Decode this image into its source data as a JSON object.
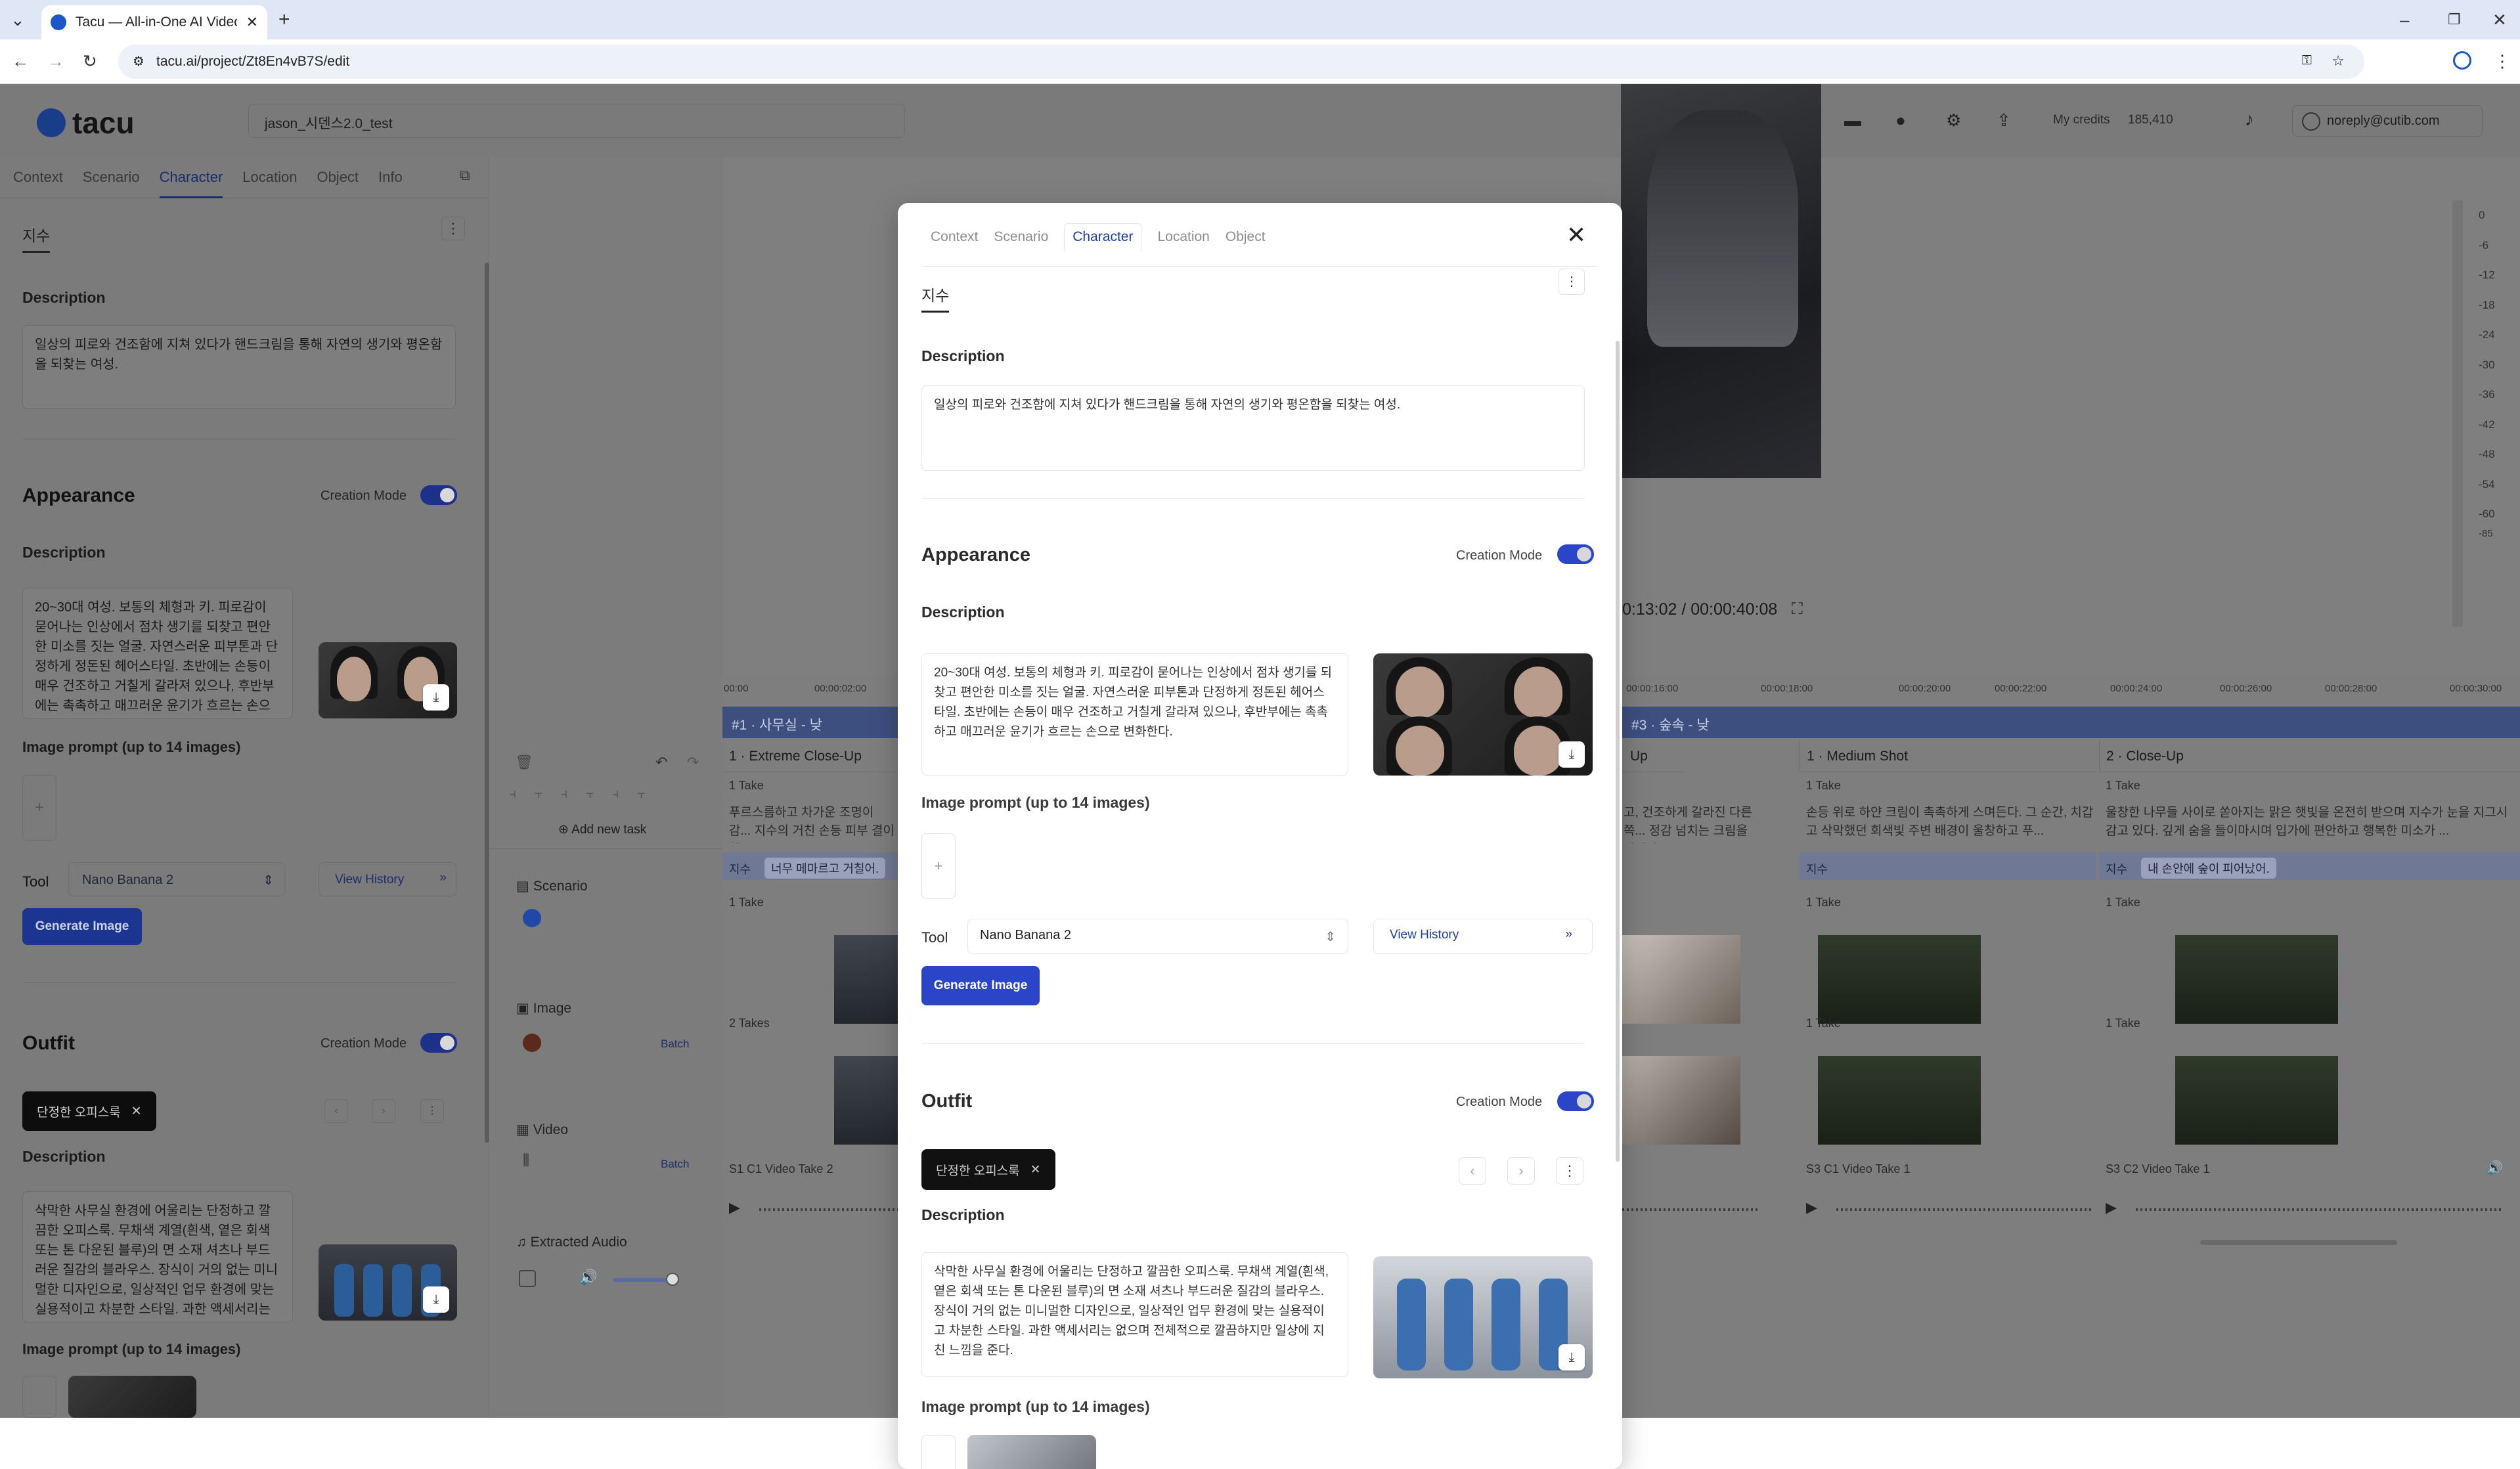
{
  "browser": {
    "tab_title": "Tacu — All-in-One AI Video P",
    "url": "tacu.ai/project/Zt8En4vB7S/edit"
  },
  "app": {
    "logo": "tacu",
    "project_name": "jason_시덴스2.0_test",
    "credits_label": "My credits",
    "credits_value": "185,410",
    "user_email": "noreply@cutib.com"
  },
  "left_panel": {
    "tabs": [
      "Context",
      "Scenario",
      "Character",
      "Location",
      "Object",
      "Info"
    ],
    "character_name": "지수",
    "description_title": "Description",
    "description": "일상의 피로와 건조함에 지쳐 있다가 핸드크림을 통해 자연의 생기와 평온함을 되찾는 여성.",
    "appearance_title": "Appearance",
    "creation_mode": "Creation Mode",
    "appearance_desc_title": "Description",
    "appearance_desc": "20~30대 여성. 보통의 체형과 키. 피로감이 묻어나는 인상에서 점차 생기를 되찾고 편안한 미소를 짓는 얼굴. 자연스러운 피부톤과 단정하게 정돈된 헤어스타일. 초반에는 손등이 매우 건조하고 거칠게 갈라져 있으나, 후반부에는 촉촉하고 매끄러운 윤기가 흐르는 손으",
    "image_prompt": "Image prompt (up to 14 images)",
    "tool": "Tool",
    "tool_value": "Nano Banana 2",
    "view_history": "View History",
    "generate": "Generate Image",
    "outfit_title": "Outfit",
    "outfit_chip": "단정한 오피스룩",
    "outfit_desc_title": "Description",
    "outfit_desc": "삭막한 사무실 환경에 어울리는 단정하고 깔끔한 오피스룩. 무채색 계열(흰색, 옅은 회색 또는 톤 다운된 블루)의 면 소재 셔츠나 부드러운 질감의 블라우스. 장식이 거의 없는 미니멀한 디자인으로, 일상적인 업무 환경에 맞는 실용적이고 차분한 스타일. 과한 액세서리는",
    "image_prompt2": "Image prompt (up to 14 images)"
  },
  "middle": {
    "add_task": "Add new task",
    "rows": [
      {
        "label": "Scenario"
      },
      {
        "label": "Image",
        "batch": "Batch"
      },
      {
        "label": "Video",
        "batch": "Batch"
      },
      {
        "label": "Extracted Audio"
      }
    ]
  },
  "timeline": {
    "ruler": [
      "00:00",
      "00:00:02:00",
      "00:00:16:00",
      "00:00:18:00",
      "00:00:20:00",
      "00:00:22:00",
      "00:00:24:00",
      "00:00:26:00",
      "00:00:28:00",
      "00:00:30:00"
    ],
    "groups": [
      {
        "label": "#1 · 사무실 - 낮"
      },
      {
        "label": "#3 · 숲속 - 낮"
      }
    ],
    "shots": [
      {
        "label": "1 · Extreme Close-Up",
        "take": "1 Take",
        "text": "푸르스름하고 차가운 조명이 감... 지수의 거친 손등 피부 결이 확...",
        "char": "지수",
        "note": "너무 메마르고 거칠어.",
        "img_take": "1 Take",
        "vid_take": "2 Takes",
        "clip": "S1 C1 Video Take 2"
      },
      {
        "label": "Up",
        "take": "",
        "text": "고, 건조하게 갈라진 다른 쪽... 정감 넘치는 크림을 파낸다...",
        "char": "",
        "note": "",
        "img_take": "",
        "vid_take": "",
        "clip": ""
      },
      {
        "label": "1 · Medium Shot",
        "take": "1 Take",
        "text": "손등 위로 하얀 크림이 촉촉하게 스며든다. 그 순간, 치갑고 삭막했던 회색빛 주변 배경이 울창하고 푸...",
        "char": "지수",
        "note": "",
        "img_take": "1 Take",
        "vid_take": "1 Take",
        "clip": "S3 C1 Video Take 1"
      },
      {
        "label": "2 · Close-Up",
        "take": "1 Take",
        "text": "울창한 나무들 사이로 쏟아지는 맑은 햇빛을 온전히 받으며 지수가 눈을 지그시 감고 있다. 깊게 숨을 들이마시며 입가에 편안하고 행복한 미소가 ...",
        "char": "지수",
        "note": "내 손안에 숲이 피어났어.",
        "img_take": "1 Take",
        "vid_take": "1 Take",
        "clip": "S3 C2 Video Take 1"
      }
    ]
  },
  "preview": {
    "time": "00:00:13:02 / 00:00:40:08",
    "time_visible": "0:13:02 / 00:00:40:08"
  },
  "vu_meter": [
    "0",
    "-6",
    "-12",
    "-18",
    "-24",
    "-30",
    "-36",
    "-42",
    "-48",
    "-54",
    "-60",
    "-85"
  ],
  "modal": {
    "tabs": [
      "Context",
      "Scenario",
      "Character",
      "Location",
      "Object"
    ],
    "active_tab": "Character",
    "character_name": "지수",
    "description_title": "Description",
    "description": "일상의 피로와 건조함에 지쳐 있다가 핸드크림을 통해 자연의 생기와 평온함을 되찾는 여성.",
    "appearance_title": "Appearance",
    "creation_mode": "Creation Mode",
    "appearance_desc_title": "Description",
    "appearance_desc": "20~30대 여성. 보통의 체형과 키. 피로감이 묻어나는 인상에서 점차 생기를 되찾고 편안한 미소를 짓는 얼굴. 자연스러운 피부톤과 단정하게 정돈된 헤어스타일. 초반에는 손등이 매우 건조하고 거칠게 갈라져 있으나, 후반부에는 촉촉하고 매끄러운 윤기가 흐르는 손으로 변화한다.",
    "image_prompt": "Image prompt (up to 14 images)",
    "tool": "Tool",
    "tool_value": "Nano Banana 2",
    "view_history": "View History",
    "generate": "Generate Image",
    "outfit_title": "Outfit",
    "outfit_chip": "단정한 오피스룩",
    "outfit_desc_title": "Description",
    "outfit_desc": "삭막한 사무실 환경에 어울리는 단정하고 깔끔한 오피스룩. 무채색 계열(흰색, 옅은 회색 또는 톤 다운된 블루)의 면 소재 셔츠나 부드러운 질감의 블라우스. 장식이 거의 없는 미니멀한 디자인으로, 일상적인 업무 환경에 맞는 실용적이고 차분한 스타일. 과한 액세서리는 없으며 전체적으로 깔끔하지만 일상에 지친 느낌을 준다.",
    "image_prompt2": "Image prompt (up to 14 images)"
  },
  "colors": {
    "accent": "#2b45b4",
    "toggle": "#2b45c8",
    "chip": "#111111"
  }
}
